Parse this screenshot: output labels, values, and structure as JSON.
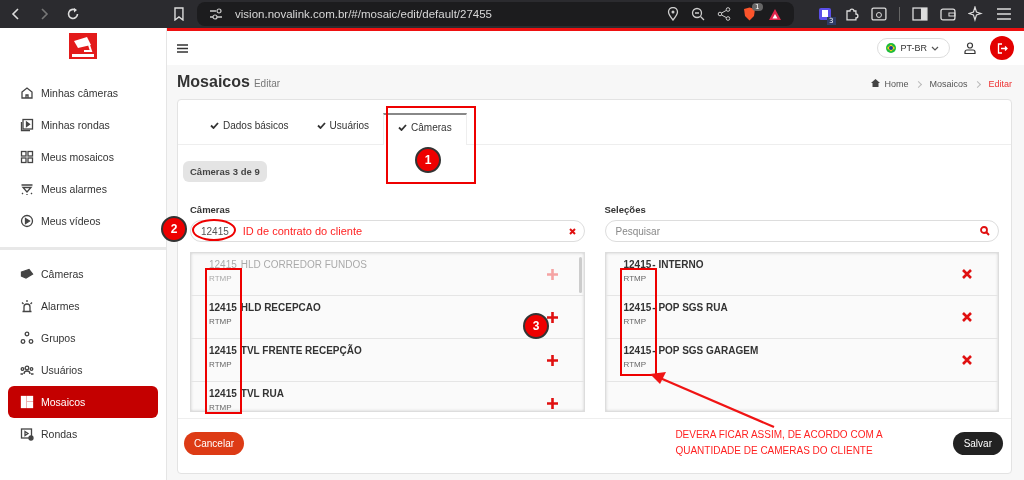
{
  "browser": {
    "url": "vision.novalink.com.br/#/mosaic/edit/default/27455",
    "shield_badge": "1",
    "extension_badge": "3"
  },
  "header": {
    "language": "PT-BR"
  },
  "sidebar": {
    "groups": [
      [
        {
          "label": "Minhas câmeras",
          "selected": false
        },
        {
          "label": "Minhas rondas",
          "selected": false
        },
        {
          "label": "Meus mosaicos",
          "selected": false
        },
        {
          "label": "Meus alarmes",
          "selected": false
        },
        {
          "label": "Meus vídeos",
          "selected": false
        }
      ],
      [
        {
          "label": "Câmeras",
          "selected": false
        },
        {
          "label": "Alarmes",
          "selected": false
        },
        {
          "label": "Grupos",
          "selected": false
        },
        {
          "label": "Usuários",
          "selected": false
        },
        {
          "label": "Mosaicos",
          "selected": true
        },
        {
          "label": "Rondas",
          "selected": false
        }
      ]
    ]
  },
  "page": {
    "title": "Mosaicos",
    "subtitle": "Editar",
    "breadcrumb": [
      {
        "label": "Home",
        "current": false
      },
      {
        "label": "Mosaicos",
        "current": false
      },
      {
        "label": "Editar",
        "current": true
      }
    ]
  },
  "tabs": [
    {
      "label": "Dados básicos",
      "selected": false
    },
    {
      "label": "Usuários",
      "selected": false
    },
    {
      "label": "Câmeras",
      "selected": true
    }
  ],
  "counter": "Câmeras 3 de 9",
  "cameras": {
    "label": "Câmeras",
    "value": "12415",
    "items": [
      {
        "id": "12415",
        "name": "HLD CORREDOR FUNDOS",
        "protocol": "RTMP",
        "disabled": true
      },
      {
        "id": "12415",
        "name": "HLD RECEPCAO",
        "protocol": "RTMP",
        "disabled": false
      },
      {
        "id": "12415",
        "name": "TVL FRENTE RECEPÇÃO",
        "protocol": "RTMP",
        "disabled": false
      },
      {
        "id": "12415",
        "name": "TVL RUA",
        "protocol": "RTMP",
        "disabled": false
      }
    ]
  },
  "selections": {
    "label": "Seleções",
    "placeholder": "Pesquisar",
    "items": [
      {
        "id": "12415",
        "name": "- INTERNO",
        "protocol": "RTMP"
      },
      {
        "id": "12415",
        "name": "- POP SGS RUA",
        "protocol": "RTMP"
      },
      {
        "id": "12415",
        "name": "- POP SGS GARAGEM",
        "protocol": "RTMP"
      }
    ]
  },
  "buttons": {
    "cancel": "Cancelar",
    "save": "Salvar"
  },
  "annotations": {
    "markers": [
      "1",
      "2",
      "3"
    ],
    "field_note": "ID de contrato do cliente",
    "note": [
      "DEVERA FICAR ASSIM, DE ACORDO COM A",
      "QUANTIDADE DE CAMERAS DO CLIENTE"
    ]
  }
}
